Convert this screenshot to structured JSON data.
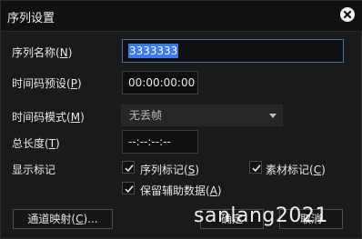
{
  "dialog": {
    "title": "序列设置"
  },
  "form": {
    "sequence_name": {
      "label": "序列名称",
      "mnemonic": "N",
      "value": "3333333"
    },
    "timecode_preset": {
      "label": "时间码预设",
      "mnemonic": "P",
      "value": "00:00:00:00"
    },
    "timecode_mode": {
      "label": "时间码模式",
      "mnemonic": "M",
      "selected": "无丢帧"
    },
    "total_length": {
      "label": "总长度",
      "mnemonic": "T",
      "value": "--:--:--:--"
    },
    "show_markers": {
      "label": "显示标记"
    }
  },
  "checkboxes": [
    {
      "label": "序列标记",
      "mnemonic": "S",
      "checked": true
    },
    {
      "label": "素材标记",
      "mnemonic": "C",
      "checked": true
    },
    {
      "label": "保留辅助数据",
      "mnemonic": "A",
      "checked": true
    }
  ],
  "buttons": {
    "channel_mapping": {
      "label": "通道映射",
      "mnemonic": "C",
      "suffix": "..."
    },
    "ok": {
      "label": "确定"
    },
    "cancel": {
      "label": "取消"
    }
  },
  "watermark": "sanlang2021",
  "icons": {
    "close": "close-icon",
    "check": "check-icon",
    "dropdown": "chevron-down-icon"
  }
}
